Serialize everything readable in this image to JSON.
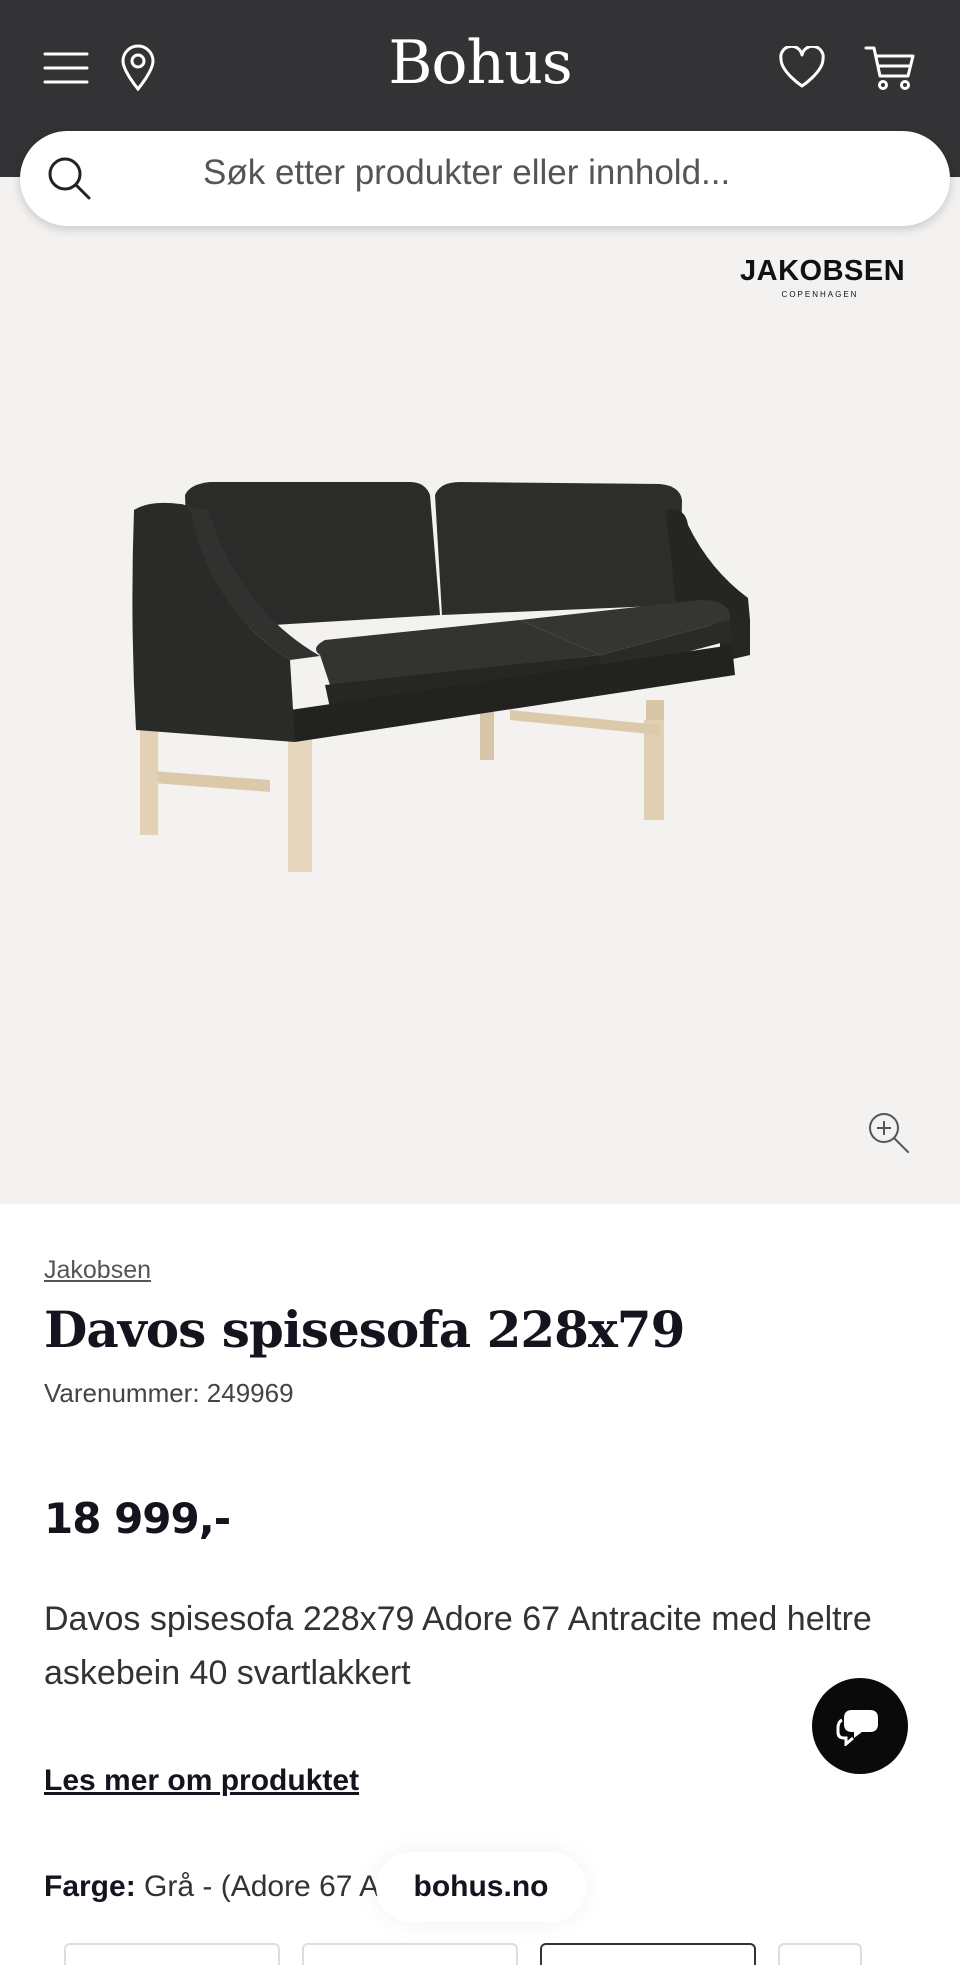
{
  "header": {
    "logo": "Bohus",
    "menu_icon": "hamburger-menu-icon",
    "location_icon": "map-pin-icon",
    "favorites_icon": "heart-icon",
    "cart_icon": "shopping-cart-icon",
    "background": "#333335"
  },
  "search": {
    "placeholder": "Søk etter produkter eller innhold...",
    "icon": "search-icon"
  },
  "gallery": {
    "brand_logo_main": "JAKOBSEN",
    "brand_logo_sub": "COPENHAGEN",
    "zoom_icon": "zoom-in-icon",
    "background": "#f4f2f0"
  },
  "product": {
    "brand": "Jakobsen",
    "title": "Davos spisesofa 228x79",
    "sku": "Varenummer: 249969",
    "price": "18 999,-",
    "description": "Davos spisesofa 228x79 Adore 67 Antracite med heltre askebein 40 svartlakkert",
    "read_more": "Les mer om produktet",
    "color_label": "Farge:",
    "color_value": "Grå - (Adore 67 A"
  },
  "chat": {
    "icon": "chat-bubbles-icon"
  },
  "browser": {
    "url": "bohus.no"
  }
}
